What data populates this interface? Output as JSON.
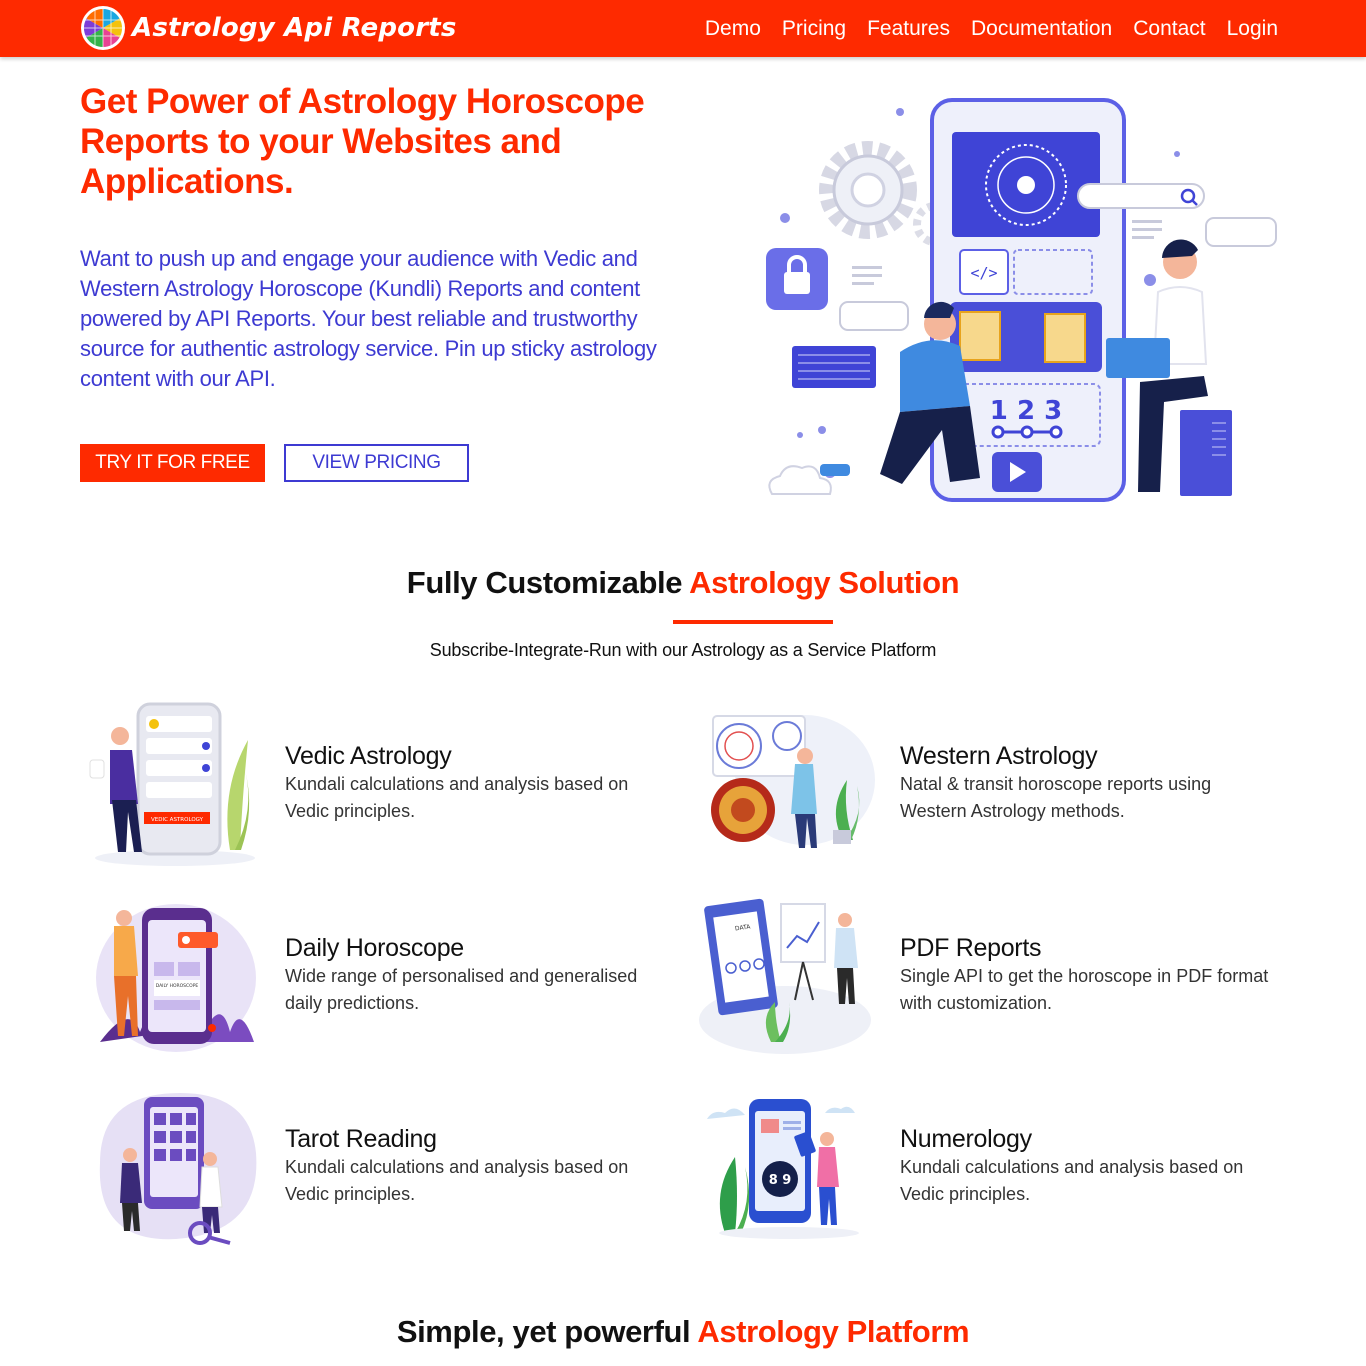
{
  "header": {
    "brand": "Astrology Api Reports",
    "nav": [
      "Demo",
      "Pricing",
      "Features",
      "Documentation",
      "Contact",
      "Login"
    ],
    "colors": {
      "brand_red": "#fe2a00",
      "accent_blue": "#3d3ad2"
    }
  },
  "hero": {
    "title": "Get Power of Astrology Horoscope Reports to your Websites and Applications.",
    "description": "Want to push up and engage your audience with Vedic and Western Astrology Horoscope (Kundli) Reports and content powered by API Reports. Your best reliable and trustworthy source for authentic astrology service. Pin up sticky astrology content with our API.",
    "primary_cta": "TRY IT FOR FREE",
    "secondary_cta": "VIEW PRICING",
    "illustration": {
      "digits": "1 2 3",
      "icons": [
        "lock-icon",
        "gear-icon",
        "search-icon",
        "code-icon",
        "play-icon"
      ]
    }
  },
  "solution": {
    "title_plain": "Fully Customizable ",
    "title_accent": "Astrology Solution",
    "subtitle": "Subscribe-Integrate-Run with our Astrology as a Service Platform",
    "features": [
      {
        "name": "Vedic Astrology",
        "description": "Kundali calculations and analysis based on Vedic principles.",
        "badge": "VEDIC ASTROLOGY",
        "icon": "vedic-astrology-illustration"
      },
      {
        "name": "Western Astrology",
        "description": "Natal & transit horoscope reports using Western Astrology methods.",
        "icon": "western-astrology-illustration"
      },
      {
        "name": "Daily Horoscope",
        "description": "Wide range of personalised and generalised daily predictions.",
        "badge": "DAILY HOROSCOPE",
        "icon": "daily-horoscope-illustration"
      },
      {
        "name": "PDF Reports",
        "description": "Single API to get the horoscope in PDF format with customization.",
        "badge": "DATA",
        "icon": "pdf-reports-illustration"
      },
      {
        "name": "Tarot Reading",
        "description": "Kundali calculations and analysis based on Vedic principles.",
        "icon": "tarot-reading-illustration"
      },
      {
        "name": "Numerology",
        "description": "Kundali calculations and analysis based on Vedic principles.",
        "badge": "8 9",
        "icon": "numerology-illustration"
      }
    ]
  },
  "platform": {
    "title_plain": "Simple, yet powerful ",
    "title_accent": "Astrology Platform"
  }
}
